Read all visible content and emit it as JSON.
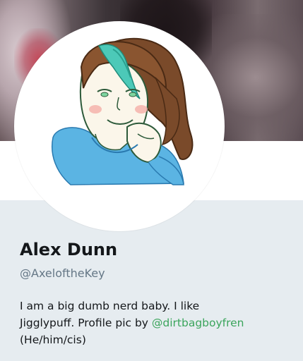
{
  "profile": {
    "name": "Alex Dunn",
    "handle": "@AxeloftheKey",
    "bio_line1": "I am a big dumb nerd baby. I like",
    "bio_line2_prefix": "Jigglypuff. Profile pic by ",
    "bio_mention": "@dirtbagboyfren",
    "bio_line3": "(He/him/cis)"
  },
  "colors": {
    "mention": "#3ba55c",
    "handle": "#657786",
    "text": "#14171a",
    "background": "#e6ecf0"
  },
  "icons": {
    "avatar": "illustrated-portrait"
  }
}
